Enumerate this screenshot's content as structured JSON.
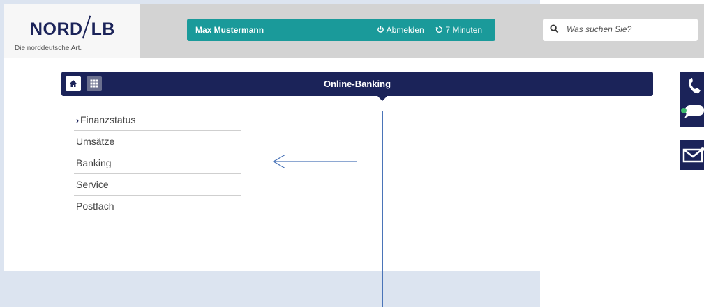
{
  "header": {
    "logo_text_left": "NORD",
    "logo_text_right": "LB",
    "logo_tagline": "Die norddeutsche Art.",
    "user_name": "Max Mustermann",
    "logout_label": "Abmelden",
    "session_timer": "7 Minuten"
  },
  "search": {
    "placeholder": "Was suchen Sie?"
  },
  "nav": {
    "title": "Online-Banking"
  },
  "menu": {
    "items": [
      {
        "label": "Finanzstatus",
        "active": true
      },
      {
        "label": "Umsätze"
      },
      {
        "label": "Banking"
      },
      {
        "label": "Service"
      },
      {
        "label": "Postfach"
      }
    ]
  },
  "colors": {
    "brand_navy": "#1b2359",
    "header_teal": "#1a9a9a",
    "annotation_blue": "#4a74b8"
  },
  "icons": {
    "home": "home-icon",
    "apps": "grid-icon",
    "search": "search-icon",
    "phone": "phone-icon",
    "chat": "chat-icon",
    "mail": "mail-icon"
  }
}
